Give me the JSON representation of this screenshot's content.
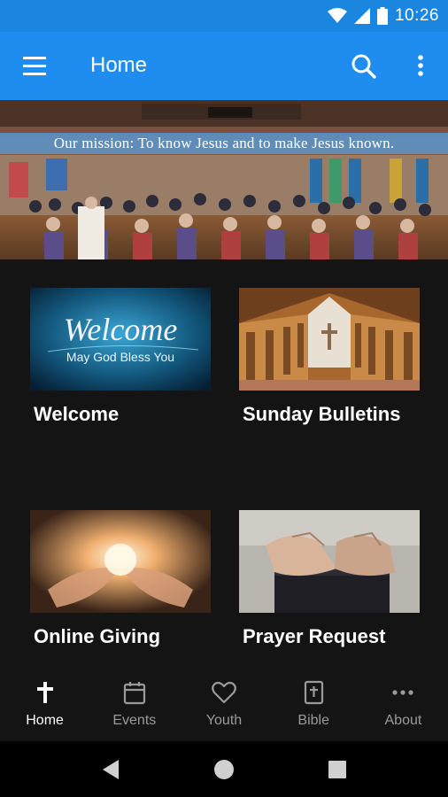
{
  "status_bar": {
    "time": "10:26",
    "icons": [
      "wifi-icon",
      "signal-icon",
      "battery-icon"
    ],
    "color": "#1a86e0"
  },
  "app_bar": {
    "title": "Home",
    "color": "#1f8df0",
    "icons": [
      "menu-icon",
      "search-icon",
      "more-vert-icon"
    ]
  },
  "banner": {
    "mission_text": "Our mission: To know Jesus and to make Jesus known."
  },
  "tiles": [
    {
      "label": "Welcome",
      "image_text_main": "Welcome",
      "image_text_sub": "May God Bless You"
    },
    {
      "label": "Sunday Bulletins"
    },
    {
      "label": "Online Giving"
    },
    {
      "label": "Prayer Request"
    }
  ],
  "bottom_nav": {
    "items": [
      {
        "label": "Home",
        "icon": "cross-icon",
        "active": true
      },
      {
        "label": "Events",
        "icon": "calendar-icon",
        "active": false
      },
      {
        "label": "Youth",
        "icon": "heart-icon",
        "active": false
      },
      {
        "label": "Bible",
        "icon": "bible-icon",
        "active": false
      },
      {
        "label": "About",
        "icon": "more-horiz-icon",
        "active": false
      }
    ]
  },
  "system_nav": {
    "buttons": [
      "back-icon",
      "home-circle-icon",
      "recents-icon"
    ]
  }
}
